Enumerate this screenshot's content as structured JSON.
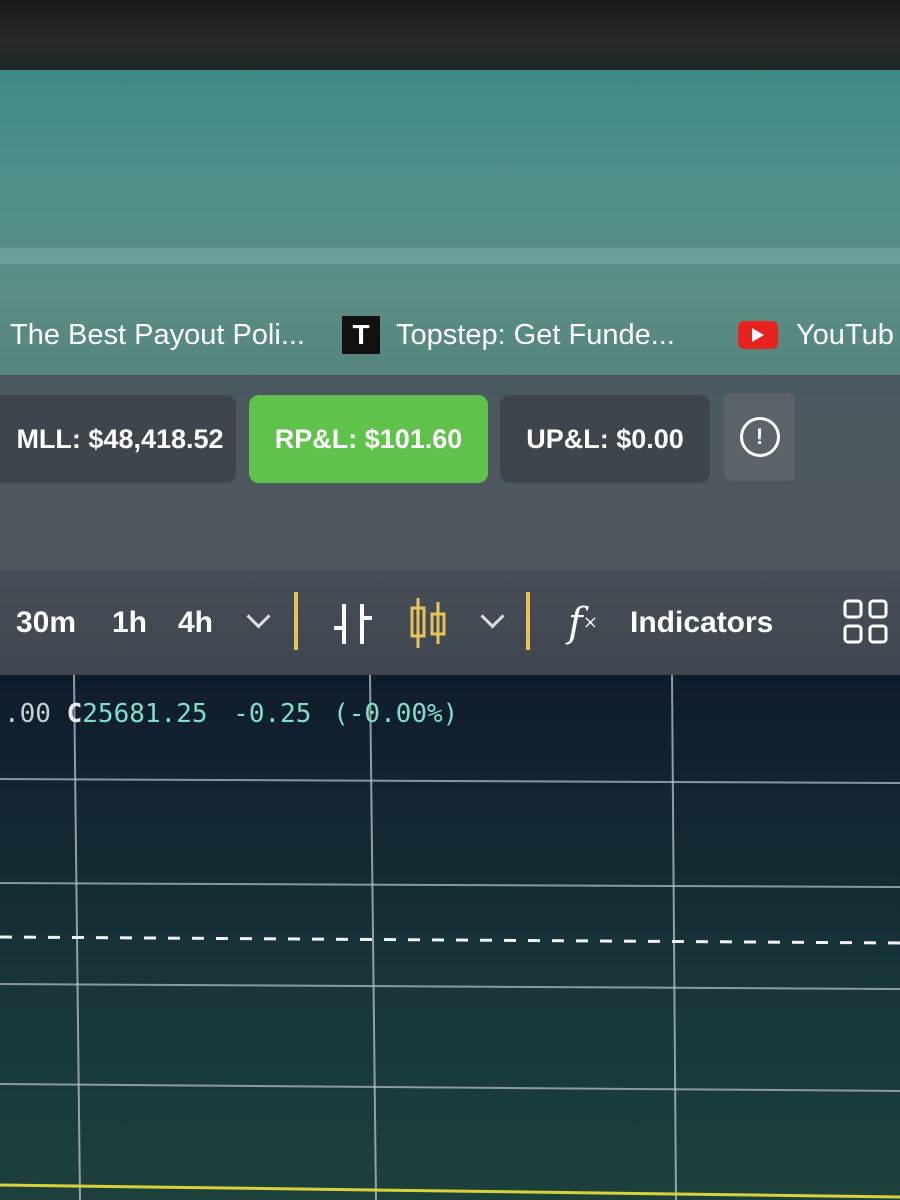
{
  "bookmarks": [
    {
      "label": "The Best Payout Poli...",
      "icon": "none"
    },
    {
      "label": "Topstep: Get Funde...",
      "icon": "topstep-t-icon",
      "icon_text": "T"
    },
    {
      "label": "YouTub",
      "icon": "youtube-icon"
    }
  ],
  "account": {
    "mll": "MLL: $48,418.52",
    "rpl": "RP&L: $101.60",
    "upl": "UP&L: $0.00"
  },
  "toolbar": {
    "timeframes": [
      "30m",
      "1h",
      "4h"
    ],
    "indicators_label": "Indicators",
    "fx_symbol": "f"
  },
  "chart": {
    "ohlc_prefix": ".00",
    "close_label": "C",
    "close_value": "25681.25",
    "change": "-0.25",
    "change_pct": "(-0.00%)"
  },
  "colors": {
    "rpl_green": "#5fc24a",
    "candle_yellow": "#e8c35a",
    "ohlc_text": "#7fe0c9",
    "chart_bg": "#132733"
  }
}
